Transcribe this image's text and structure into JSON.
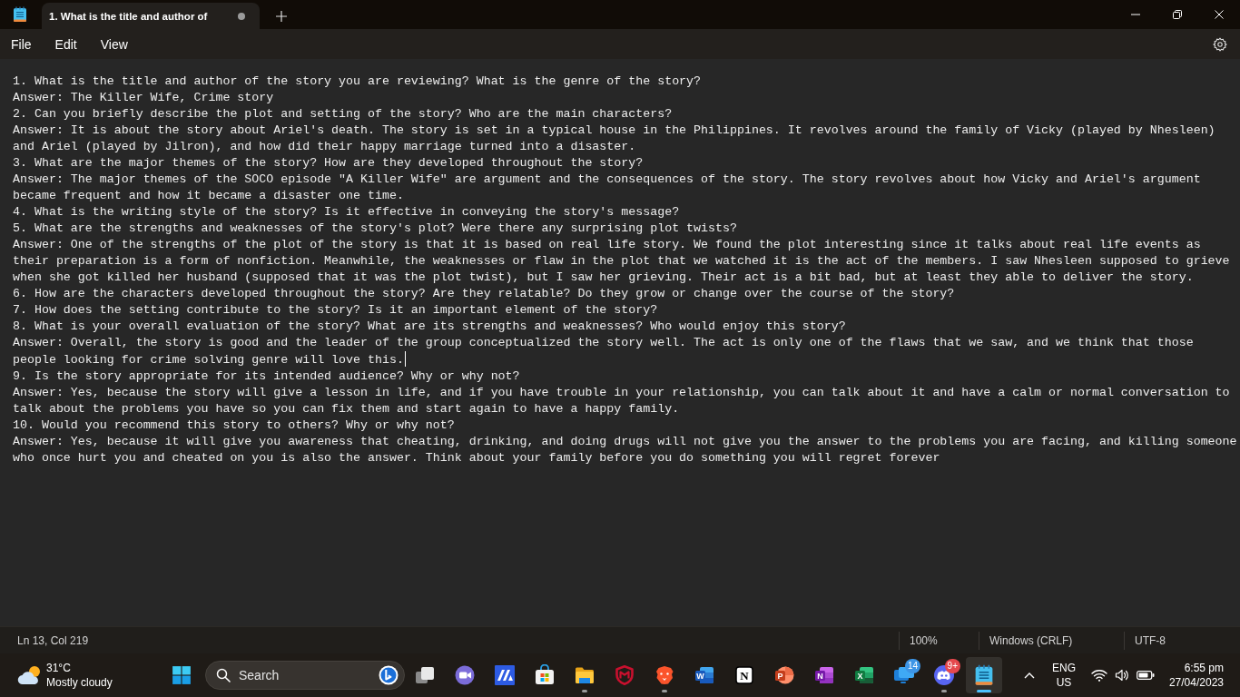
{
  "window": {
    "tabs": [
      {
        "title": "1. What is the title and author of",
        "selected": true,
        "unsaved": true
      }
    ]
  },
  "menu": [
    "File",
    "Edit",
    "View"
  ],
  "document": {
    "lines": [
      {
        "text": "1. What is the title and author of the story you are reviewing? What is the genre of the story?",
        "cursor": false
      },
      {
        "text": "Answer: The Killer Wife, Crime story",
        "cursor": false
      },
      {
        "text": "2. Can you briefly describe the plot and setting of the story? Who are the main characters?",
        "cursor": false
      },
      {
        "text": "Answer: It is about the story about Ariel's death. The story is set in a typical house in the Philippines. It revolves around the family of Vicky (played by Nhesleen) and Ariel (played by Jilron), and how did their happy marriage turned into a disaster.",
        "cursor": false
      },
      {
        "text": "3. What are the major themes of the story? How are they developed throughout the story?",
        "cursor": false
      },
      {
        "text": "Answer: The major themes of the SOCO episode \"A Killer Wife\" are argument and the consequences of the story. The story revolves about how Vicky and Ariel's argument became frequent and how it became a disaster one time.",
        "cursor": false
      },
      {
        "text": "4. What is the writing style of the story? Is it effective in conveying the story's message?",
        "cursor": false
      },
      {
        "text": "5. What are the strengths and weaknesses of the story's plot? Were there any surprising plot twists?",
        "cursor": false
      },
      {
        "text": "Answer: One of the strengths of the plot of the story is that it is based on real life story. We found the plot interesting since it talks about real life events as their preparation is a form of nonfiction. Meanwhile, the weaknesses or flaw in the plot that we watched it is the act of the members. I saw Nhesleen supposed to grieve when she got killed her husband (supposed that it was the plot twist), but I saw her grieving. Their act is a bit bad, but at least they able to deliver the story.",
        "cursor": false
      },
      {
        "text": "6. How are the characters developed throughout the story? Are they relatable? Do they grow or change over the course of the story?",
        "cursor": false
      },
      {
        "text": "7. How does the setting contribute to the story? Is it an important element of the story?",
        "cursor": false
      },
      {
        "text": "8. What is your overall evaluation of the story? What are its strengths and weaknesses? Who would enjoy this story?",
        "cursor": false
      },
      {
        "text": "Answer: Overall, the story is good and the leader of the group conceptualized the story well. The act is only one of the flaws that we saw, and we think that those people looking for crime solving genre will love this.",
        "cursor": true
      },
      {
        "text": "9. Is the story appropriate for its intended audience? Why or why not?",
        "cursor": false
      },
      {
        "text": "Answer: Yes, because the story will give a lesson in life, and if you have trouble in your relationship, you can talk about it and have a calm or normal conversation to talk about the problems you have so you can fix them and start again to have a happy family.",
        "cursor": false
      },
      {
        "text": "10. Would you recommend this story to others? Why or why not?",
        "cursor": false
      },
      {
        "text": "Answer: Yes, because it will give you awareness that cheating, drinking, and doing drugs will not give you the answer to the problems you are facing, and killing someone who once hurt you and cheated on you is also the answer. Think about your family before you do something you will regret forever",
        "cursor": false
      }
    ]
  },
  "status_bar": {
    "position": "Ln 13, Col 219",
    "zoom": "100%",
    "line_ending": "Windows (CRLF)",
    "encoding": "UTF-8"
  },
  "taskbar": {
    "weather": {
      "temperature": "31°C",
      "condition": "Mostly cloudy"
    },
    "search": {
      "placeholder": "Search"
    },
    "apps": [
      {
        "kind": "taskview",
        "running": false,
        "selected": false
      },
      {
        "kind": "meet",
        "running": false,
        "selected": false
      },
      {
        "kind": "stripes",
        "running": false,
        "selected": false
      },
      {
        "kind": "store",
        "running": false,
        "selected": false
      },
      {
        "kind": "folder",
        "running": true,
        "selected": false
      },
      {
        "kind": "shield",
        "running": false,
        "selected": false
      },
      {
        "kind": "lion",
        "running": true,
        "selected": false
      },
      {
        "kind": "word",
        "letter": "W",
        "running": false,
        "selected": false
      },
      {
        "kind": "notion",
        "letter": "N",
        "running": false,
        "selected": false
      },
      {
        "kind": "powerpoint",
        "letter": "P",
        "running": false,
        "selected": false
      },
      {
        "kind": "onenote",
        "letter": "N",
        "running": false,
        "selected": false
      },
      {
        "kind": "excel",
        "letter": "X",
        "running": false,
        "selected": false
      },
      {
        "kind": "screens",
        "running": false,
        "selected": false,
        "badge": {
          "text": "14",
          "color": "#3d95e6"
        }
      },
      {
        "kind": "discord",
        "running": true,
        "selected": false,
        "badge": {
          "text": "9+",
          "color": "#e5484d"
        }
      },
      {
        "kind": "notepad",
        "running": true,
        "selected": true
      }
    ],
    "tray": {
      "language": "ENG",
      "region": "US"
    },
    "clock": {
      "time": "6:55 pm",
      "date": "27/04/2023"
    }
  }
}
